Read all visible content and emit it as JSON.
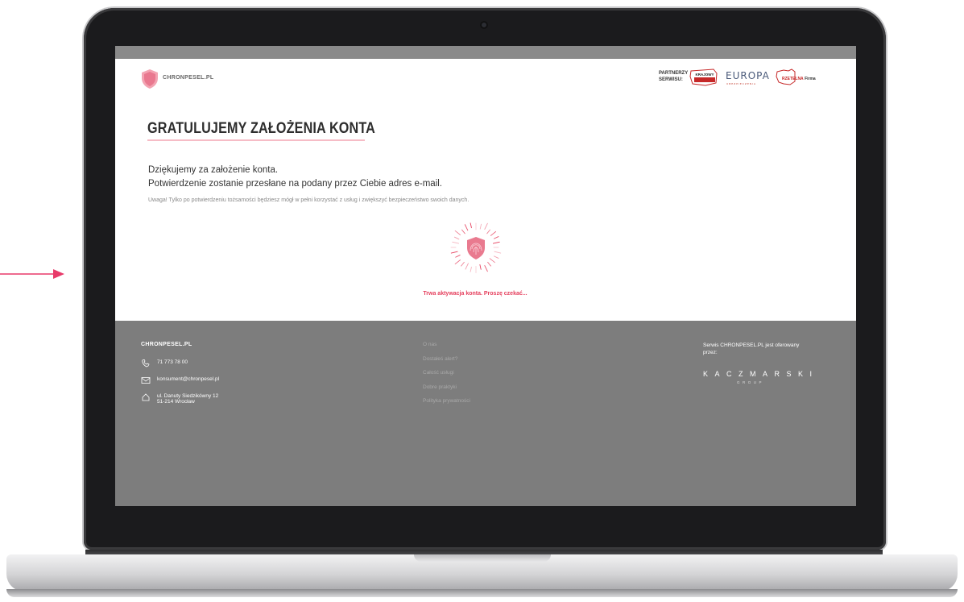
{
  "header": {
    "logo_text": "CHRONPESEL.PL",
    "partners_label_1": "PARTNERZY",
    "partners_label_2": "SERWISU:",
    "partner1_name": "KRAJOWY",
    "partner2_name": "EUROPA",
    "partner2_sub": "UBEZPIECZENIA",
    "partner3_red": "RZETELNA",
    "partner3_dark": "Firma"
  },
  "main": {
    "title": "GRATULUJEMY ZAŁOŻENIA KONTA",
    "line1": "Dziękujemy za założenie konta.",
    "line2": "Potwierdzenie zostanie przesłane na podany przez Ciebie adres e-mail.",
    "note": "Uwaga! Tylko po potwierdzeniu tożsamości będziesz mógł w pełni korzystać z usług i zwiększyć bezpieczeństwo swoich danych.",
    "status": "Trwa aktywacja konta. Proszę czekać..."
  },
  "footer": {
    "brand": "CHRONPESEL.PL",
    "phone": "71 773 78 00",
    "email": "konsument@chronpesel.pl",
    "address_line1": "ul. Danuty Siedzikówny 12",
    "address_line2": "51-214 Wrocław",
    "links": [
      "O nas",
      "Dostałeś alert?",
      "Całość usługi",
      "Dobre praktyki",
      "Polityka prywatności"
    ],
    "offer_text": "Serwis CHRONPESEL.PL jest oferowany przez:",
    "company": "KACZMARSKI",
    "company_sub": "GROUP"
  },
  "colors": {
    "accent": "#e53e5c",
    "footer_bg": "#7d7d7d",
    "header_bg": "#ffffff"
  }
}
